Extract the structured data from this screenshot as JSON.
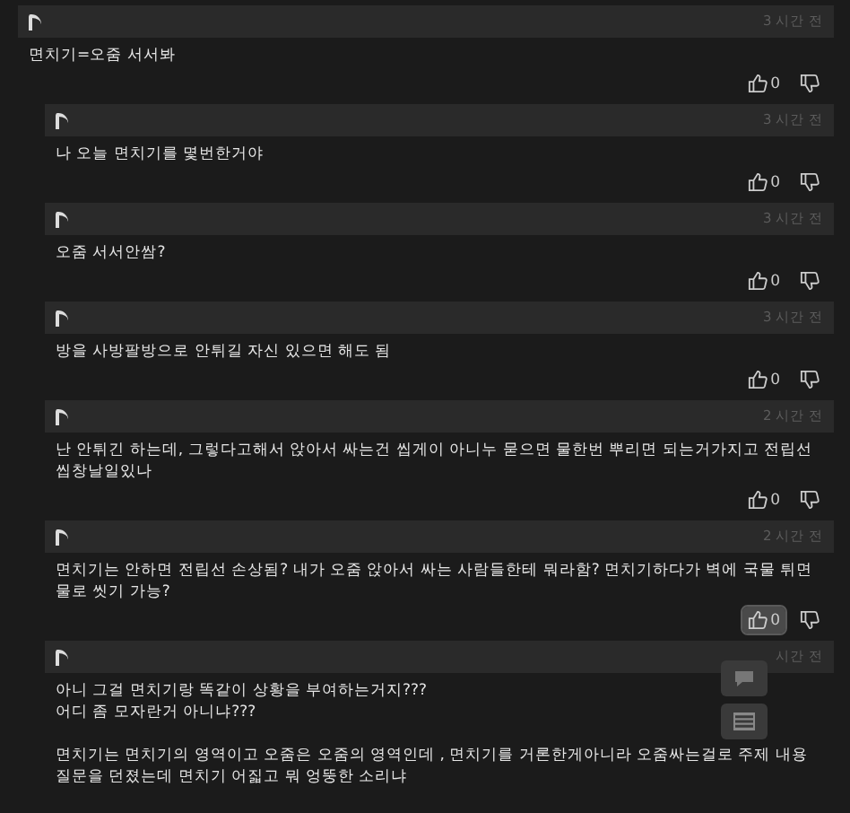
{
  "comments": [
    {
      "reply": false,
      "time": "3 시간 전",
      "lines": [
        "면치기=오줌 서서봐"
      ],
      "likes": "0",
      "like_highlighted": false
    },
    {
      "reply": true,
      "time": "3 시간 전",
      "lines": [
        "나 오늘 면치기를 몇번한거야"
      ],
      "likes": "0",
      "like_highlighted": false
    },
    {
      "reply": true,
      "time": "3 시간 전",
      "lines": [
        "오줌 서서안쌈?"
      ],
      "likes": "0",
      "like_highlighted": false
    },
    {
      "reply": true,
      "time": "3 시간 전",
      "lines": [
        "방을 사방팔방으로 안튀길 자신 있으면 해도 됨"
      ],
      "likes": "0",
      "like_highlighted": false
    },
    {
      "reply": true,
      "time": "2 시간 전",
      "lines": [
        "난 안튀긴 하는데, 그렇다고해서 앉아서 싸는건 씹게이 아니누 묻으면 물한번 뿌리면 되는거가지고 전립선 씹창날일있나"
      ],
      "likes": "0",
      "like_highlighted": false
    },
    {
      "reply": true,
      "time": "2 시간 전",
      "lines": [
        "면치기는 안하면 전립선 손상됨? 내가 오줌 앉아서 싸는 사람들한테 뭐라함? 면치기하다가 벽에 국물 튀면 물로 씻기 가능?"
      ],
      "likes": "0",
      "like_highlighted": true
    },
    {
      "reply": true,
      "time": "시간 전",
      "lines": [
        "아니 그걸 면치기랑 똑같이 상황을 부여하는거지???",
        "어디 좀 모자란거 아니냐???"
      ],
      "more_lines": [
        "면치기는 면치기의 영역이고 오줌은 오줌의 영역인데 , 면치기를 거론한게아니라 오줌싸는걸로 주제 내용 질문을 던졌는데 면치기 어짋고 뭐 엉뚱한 소리냐"
      ]
    }
  ],
  "floating_buttons": [
    {
      "kind": "comment"
    },
    {
      "kind": "list"
    }
  ]
}
